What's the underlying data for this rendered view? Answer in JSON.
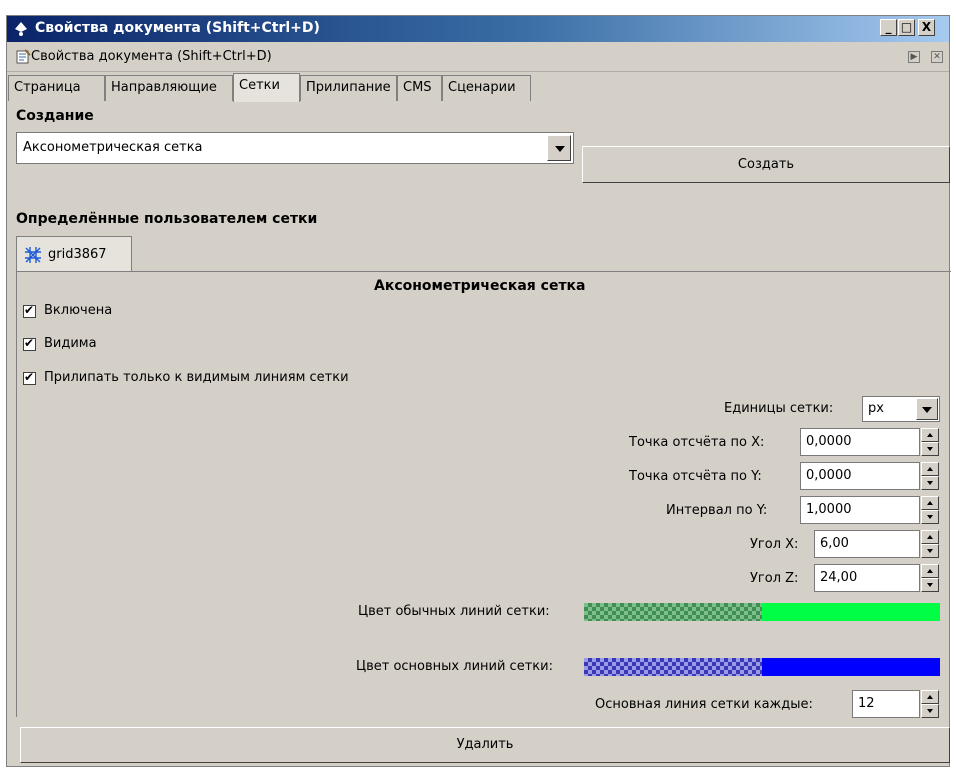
{
  "window": {
    "title": "Свойства документа (Shift+Ctrl+D)",
    "controls": [
      "_",
      "□",
      "X"
    ]
  },
  "dock": {
    "title": "Свойства документа (Shift+Ctrl+D)",
    "controls": [
      "▶",
      "✕"
    ]
  },
  "tabs": [
    "Страница",
    "Направляющие",
    "Сетки",
    "Прилипание",
    "CMS",
    "Сценарии"
  ],
  "active_tab": "Сетки",
  "creation": {
    "heading": "Создание",
    "grid_type": "Аксонометрическая сетка",
    "create_button": "Создать"
  },
  "user_grids": {
    "heading": "Определённые пользователем сетки",
    "grid_tab": "grid3867"
  },
  "panel": {
    "title": "Аксонометрическая сетка",
    "enabled_label": "Включена",
    "enabled": true,
    "visible_label": "Видима",
    "visible": true,
    "snap_visible_label": "Прилипать только к видимым линиям сетки",
    "snap_visible": true,
    "units_label": "Единицы сетки:",
    "units_value": "px",
    "origin_x_label": "Точка отсчёта по X:",
    "origin_x": "0,0000",
    "origin_y_label": "Точка отсчёта по Y:",
    "origin_y": "0,0000",
    "spacing_y_label": "Интервал по Y:",
    "spacing_y": "1,0000",
    "angle_x_label": "Угол X:",
    "angle_x": "6,00",
    "angle_z_label": "Угол Z:",
    "angle_z": "24,00",
    "minor_color_label": "Цвет обычных линий сетки:",
    "minor_color": "#00ff44",
    "major_color_label": "Цвет основных линий сетки:",
    "major_color": "#0000ff",
    "major_every_label": "Основная линия сетки каждые:",
    "major_every": "12",
    "delete_button": "Удалить"
  },
  "colors": {
    "titlebar_start": "#0a246a",
    "face": "#d4d0c8"
  }
}
